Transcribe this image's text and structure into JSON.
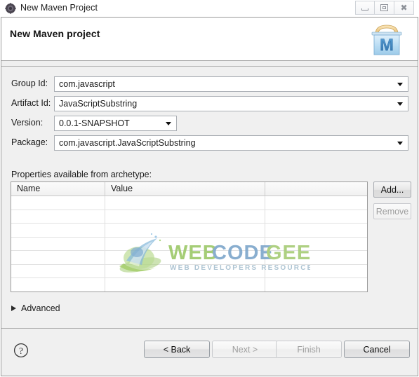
{
  "window": {
    "title": "New Maven Project",
    "icon": "eclipse-icon",
    "controls": {
      "minimize": "minimize-icon",
      "maximize": "maximize-icon",
      "close": "close-icon"
    }
  },
  "wizard": {
    "heading": "New Maven project",
    "banner_icon": "maven-project-icon"
  },
  "form": {
    "fields": [
      {
        "label": "Group Id:",
        "value": "com.javascript",
        "combo": true,
        "wide": true
      },
      {
        "label": "Artifact Id:",
        "value": "JavaScriptSubstring",
        "combo": true,
        "wide": true
      },
      {
        "label": "Version:",
        "value": "0.0.1-SNAPSHOT",
        "combo": true,
        "wide": false
      },
      {
        "label": "Package:",
        "value": "com.javascript.JavaScriptSubstring",
        "combo": true,
        "wide": true
      }
    ]
  },
  "properties": {
    "label": "Properties available from archetype:",
    "columns": [
      "Name",
      "Value",
      ""
    ],
    "rows": [],
    "empty_row_count": 7,
    "buttons": {
      "add": {
        "label": "Add...",
        "enabled": true
      },
      "remove": {
        "label": "Remove",
        "enabled": false
      }
    }
  },
  "advanced": {
    "label": "Advanced",
    "expanded": false,
    "icon": "triangle-right-icon"
  },
  "watermark": {
    "title": "WEB CODE GEEKS",
    "subtitle": "WEB DEVELOPERS RESOURCE CENTER",
    "colors": {
      "green": "#8cbf3f",
      "blue": "#6f9fc8",
      "light_green": "#aacd6a"
    }
  },
  "footer": {
    "help_icon": "help-icon",
    "buttons": [
      {
        "label": "< Back",
        "enabled": true
      },
      {
        "label": "Next >",
        "enabled": false
      },
      {
        "label": "Finish",
        "enabled": false
      },
      {
        "label": "Cancel",
        "enabled": true
      }
    ]
  },
  "colors": {
    "dialog_bg": "#f0f0f0",
    "header_bg": "#ffffff",
    "border": "#9a9a9a",
    "text": "#1a1a1a"
  }
}
